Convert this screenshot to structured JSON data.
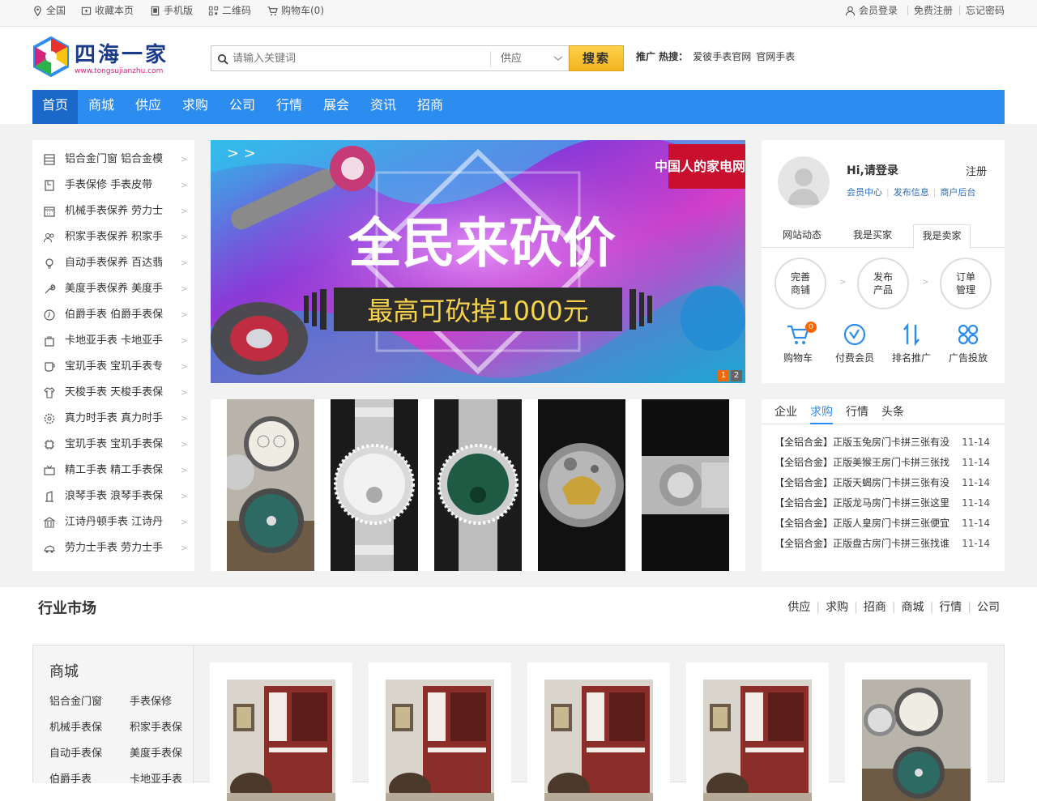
{
  "topbar": {
    "left": [
      "全国",
      "收藏本页",
      "手机版",
      "二维码",
      "购物车(0)"
    ],
    "right": [
      "会员登录",
      "免费注册",
      "忘记密码"
    ]
  },
  "logo": {
    "name": "四海一家",
    "url": "www.tongsujianzhu.com"
  },
  "search": {
    "placeholder": "请输入关键词",
    "category": "供应",
    "button": "搜索"
  },
  "hot": {
    "label": "推广 热搜：",
    "keywords": [
      "爱彼手表官网",
      "官网手表"
    ]
  },
  "nav": [
    "首页",
    "商城",
    "供应",
    "求购",
    "公司",
    "行情",
    "展会",
    "资讯",
    "招商"
  ],
  "left_menu": [
    {
      "label": "铝合金门窗 铝合金模",
      "icon": "window-icon"
    },
    {
      "label": "手表保修 手表皮带",
      "icon": "document-icon"
    },
    {
      "label": "机械手表保养 劳力士",
      "icon": "calendar-icon"
    },
    {
      "label": "积家手表保养 积家手",
      "icon": "people-icon"
    },
    {
      "label": "自动手表保养 百达翡",
      "icon": "bulb-icon"
    },
    {
      "label": "美度手表保养 美度手",
      "icon": "wrench-icon"
    },
    {
      "label": "伯爵手表 伯爵手表保",
      "icon": "clock-icon"
    },
    {
      "label": "卡地亚手表 卡地亚手",
      "icon": "bag-icon"
    },
    {
      "label": "宝玑手表 宝玑手表专",
      "icon": "cup-icon"
    },
    {
      "label": "天梭手表 天梭手表保",
      "icon": "shirt-icon"
    },
    {
      "label": "真力时手表 真力时手",
      "icon": "gear-icon"
    },
    {
      "label": "宝玑手表 宝玑手表保",
      "icon": "chip-icon"
    },
    {
      "label": "精工手表 精工手表保",
      "icon": "tv-icon"
    },
    {
      "label": "浪琴手表 浪琴手表保",
      "icon": "pin-icon"
    },
    {
      "label": "江诗丹顿手表 江诗丹",
      "icon": "bank-icon"
    },
    {
      "label": "劳力士手表 劳力士手",
      "icon": "car-icon"
    }
  ],
  "banner": {
    "headline": "全民来砍价",
    "sub": "最高可砍掉1000元",
    "badge": "中国人的家电网购",
    "pages": [
      "1",
      "2"
    ]
  },
  "user": {
    "greeting": "Hi,请登录",
    "register": "注册",
    "links": [
      "会员中心",
      "发布信息",
      "商户后台"
    ],
    "tabs": [
      "网站动态",
      "我是买家",
      "我是卖家"
    ],
    "steps": [
      [
        "完善",
        "商铺"
      ],
      [
        "发布",
        "产品"
      ],
      [
        "订单",
        "管理"
      ]
    ],
    "quick": [
      {
        "label": "购物车",
        "icon": "cart-icon",
        "badge": "0"
      },
      {
        "label": "付费会员",
        "icon": "vip-icon"
      },
      {
        "label": "排名推广",
        "icon": "sort-icon"
      },
      {
        "label": "广告投放",
        "icon": "apps-icon"
      }
    ]
  },
  "news": {
    "tabs": [
      "企业",
      "求购",
      "行情",
      "头条"
    ],
    "active_tab": "求购",
    "items": [
      {
        "title": "【全铝合金】正版玉兔房门卡拼三张有没",
        "date": "11-14"
      },
      {
        "title": "【全铝合金】正版美猴王房门卡拼三张找",
        "date": "11-14"
      },
      {
        "title": "【全铝合金】正版天蝎房门卡拼三张有没",
        "date": "11-14"
      },
      {
        "title": "【全铝合金】正版龙马房门卡拼三张这里",
        "date": "11-14"
      },
      {
        "title": "【全铝合金】正版人皇房门卡拼三张便宜",
        "date": "11-14"
      },
      {
        "title": "【全铝合金】正版盘古房门卡拼三张找谁",
        "date": "11-14"
      }
    ]
  },
  "market": {
    "title": "行业市场",
    "links": [
      "供应",
      "求购",
      "招商",
      "商城",
      "行情",
      "公司"
    ],
    "side_title": "商城",
    "side_links": [
      "铝合金门窗",
      "手表保修",
      "机械手表保",
      "积家手表保",
      "自动手表保",
      "美度手表保",
      "伯爵手表",
      "卡地亚手表"
    ]
  },
  "colors": {
    "nav": "#2d8cf0",
    "nav_active": "#1a68c9",
    "search_btn": "#f4b320",
    "link": "#2d6cc0"
  }
}
